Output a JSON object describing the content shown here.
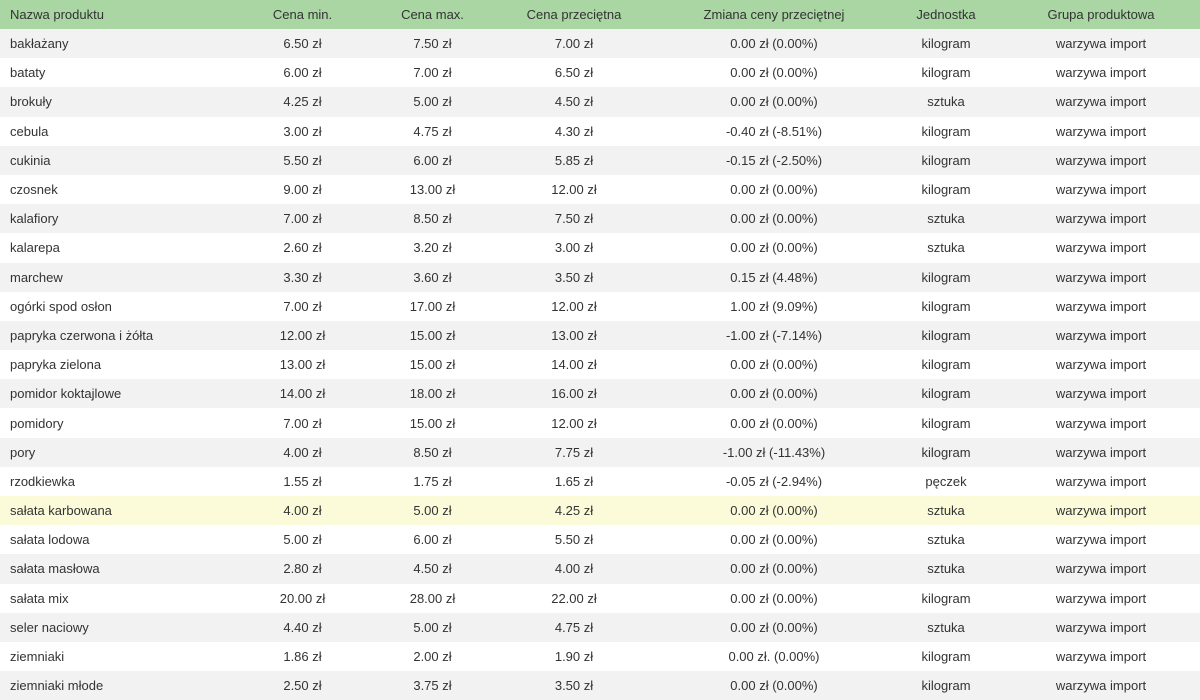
{
  "table": {
    "headers": {
      "name": "Nazwa produktu",
      "min": "Cena min.",
      "max": "Cena max.",
      "avg": "Cena przeciętna",
      "change": "Zmiana ceny przeciętnej",
      "unit": "Jednostka",
      "group": "Grupa produktowa"
    },
    "highlighted_row_index": 16,
    "rows": [
      {
        "name": "bakłażany",
        "min": "6.50 zł",
        "max": "7.50 zł",
        "avg": "7.00 zł",
        "change": "0.00 zł (0.00%)",
        "unit": "kilogram",
        "group": "warzywa import"
      },
      {
        "name": "bataty",
        "min": "6.00 zł",
        "max": "7.00 zł",
        "avg": "6.50 zł",
        "change": "0.00 zł (0.00%)",
        "unit": "kilogram",
        "group": "warzywa import"
      },
      {
        "name": "brokuły",
        "min": "4.25 zł",
        "max": "5.00 zł",
        "avg": "4.50 zł",
        "change": "0.00 zł (0.00%)",
        "unit": "sztuka",
        "group": "warzywa import"
      },
      {
        "name": "cebula",
        "min": "3.00 zł",
        "max": "4.75 zł",
        "avg": "4.30 zł",
        "change": "-0.40 zł (-8.51%)",
        "unit": "kilogram",
        "group": "warzywa import"
      },
      {
        "name": "cukinia",
        "min": "5.50 zł",
        "max": "6.00 zł",
        "avg": "5.85 zł",
        "change": "-0.15 zł (-2.50%)",
        "unit": "kilogram",
        "group": "warzywa import"
      },
      {
        "name": "czosnek",
        "min": "9.00 zł",
        "max": "13.00 zł",
        "avg": "12.00 zł",
        "change": "0.00 zł (0.00%)",
        "unit": "kilogram",
        "group": "warzywa import"
      },
      {
        "name": "kalafiory",
        "min": "7.00 zł",
        "max": "8.50 zł",
        "avg": "7.50 zł",
        "change": "0.00 zł (0.00%)",
        "unit": "sztuka",
        "group": "warzywa import"
      },
      {
        "name": "kalarepa",
        "min": "2.60 zł",
        "max": "3.20 zł",
        "avg": "3.00 zł",
        "change": "0.00 zł (0.00%)",
        "unit": "sztuka",
        "group": "warzywa import"
      },
      {
        "name": "marchew",
        "min": "3.30 zł",
        "max": "3.60 zł",
        "avg": "3.50 zł",
        "change": "0.15 zł (4.48%)",
        "unit": "kilogram",
        "group": "warzywa import"
      },
      {
        "name": "ogórki spod osłon",
        "min": "7.00 zł",
        "max": "17.00 zł",
        "avg": "12.00 zł",
        "change": "1.00 zł (9.09%)",
        "unit": "kilogram",
        "group": "warzywa import"
      },
      {
        "name": "papryka czerwona i żółta",
        "min": "12.00 zł",
        "max": "15.00 zł",
        "avg": "13.00 zł",
        "change": "-1.00 zł (-7.14%)",
        "unit": "kilogram",
        "group": "warzywa import"
      },
      {
        "name": "papryka zielona",
        "min": "13.00 zł",
        "max": "15.00 zł",
        "avg": "14.00 zł",
        "change": "0.00 zł (0.00%)",
        "unit": "kilogram",
        "group": "warzywa import"
      },
      {
        "name": "pomidor koktajlowe",
        "min": "14.00 zł",
        "max": "18.00 zł",
        "avg": "16.00 zł",
        "change": "0.00 zł (0.00%)",
        "unit": "kilogram",
        "group": "warzywa import"
      },
      {
        "name": "pomidory",
        "min": "7.00 zł",
        "max": "15.00 zł",
        "avg": "12.00 zł",
        "change": "0.00 zł (0.00%)",
        "unit": "kilogram",
        "group": "warzywa import"
      },
      {
        "name": "pory",
        "min": "4.00 zł",
        "max": "8.50 zł",
        "avg": "7.75 zł",
        "change": "-1.00 zł (-11.43%)",
        "unit": "kilogram",
        "group": "warzywa import"
      },
      {
        "name": "rzodkiewka",
        "min": "1.55 zł",
        "max": "1.75 zł",
        "avg": "1.65 zł",
        "change": "-0.05 zł (-2.94%)",
        "unit": "pęczek",
        "group": "warzywa import"
      },
      {
        "name": "sałata karbowana",
        "min": "4.00 zł",
        "max": "5.00 zł",
        "avg": "4.25 zł",
        "change": "0.00 zł (0.00%)",
        "unit": "sztuka",
        "group": "warzywa import"
      },
      {
        "name": "sałata lodowa",
        "min": "5.00 zł",
        "max": "6.00 zł",
        "avg": "5.50 zł",
        "change": "0.00 zł (0.00%)",
        "unit": "sztuka",
        "group": "warzywa import"
      },
      {
        "name": "sałata masłowa",
        "min": "2.80 zł",
        "max": "4.50 zł",
        "avg": "4.00 zł",
        "change": "0.00 zł (0.00%)",
        "unit": "sztuka",
        "group": "warzywa import"
      },
      {
        "name": "sałata mix",
        "min": "20.00 zł",
        "max": "28.00 zł",
        "avg": "22.00 zł",
        "change": "0.00 zł (0.00%)",
        "unit": "kilogram",
        "group": "warzywa import"
      },
      {
        "name": "seler naciowy",
        "min": "4.40 zł",
        "max": "5.00 zł",
        "avg": "4.75 zł",
        "change": "0.00 zł (0.00%)",
        "unit": "sztuka",
        "group": "warzywa import"
      },
      {
        "name": "ziemniaki",
        "min": "1.86 zł",
        "max": "2.00 zł",
        "avg": "1.90 zł",
        "change": "0.00 zł. (0.00%)",
        "unit": "kilogram",
        "group": "warzywa import"
      },
      {
        "name": "ziemniaki młode",
        "min": "2.50 zł",
        "max": "3.75 zł",
        "avg": "3.50 zł",
        "change": "0.00 zł (0.00%)",
        "unit": "kilogram",
        "group": "warzywa import"
      }
    ]
  },
  "colors": {
    "header_bg": "#a9d6a3",
    "row_odd_bg": "#f2f2f2",
    "row_even_bg": "#ffffff",
    "row_highlight_bg": "#fbfbd9",
    "text": "#333333"
  }
}
